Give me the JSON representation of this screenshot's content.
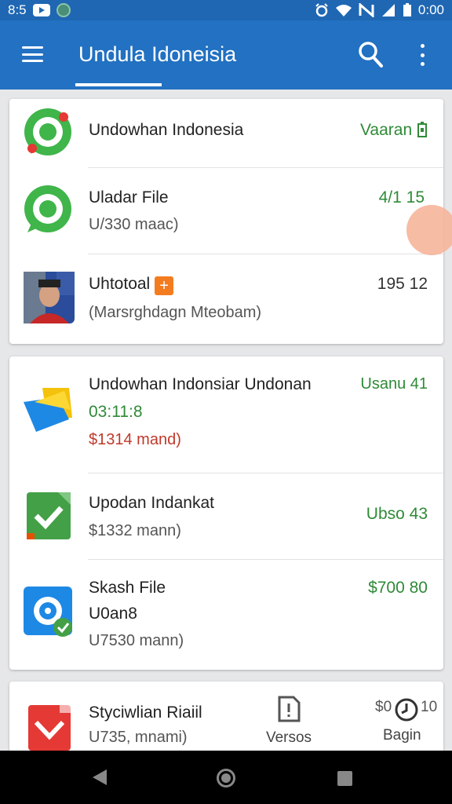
{
  "status_bar": {
    "time_left": "8:5",
    "time_right": "0:00"
  },
  "app_bar": {
    "title": "Undula Idoneisia"
  },
  "card1": [
    {
      "title": "Undowhan Indonesia",
      "right": "Vaaran"
    },
    {
      "title": "Uladar File",
      "subtitle": "U/330 maac)",
      "right": "4/1 15"
    },
    {
      "title": "Uhtotoal",
      "subtitle": "(Marsrghdagn Mteobam)",
      "right": "195 12"
    }
  ],
  "card2": [
    {
      "title": "Undowhan Indonsiar Undonan",
      "line2": "03:11:8",
      "line3": "$1314 mand)",
      "right": "Usanu 41"
    },
    {
      "title": "Upodan Indankat",
      "subtitle": "$1332 mann)",
      "right": "Ubso 43"
    },
    {
      "title": "Skash File",
      "line2": "U0an8",
      "subtitle": "U7530 mann)",
      "right": "$700 80"
    }
  ],
  "card3": {
    "title": "Styciwlian Riaiil",
    "subtitle": "U735, mnami)",
    "action1": "Versos",
    "right_top": "$0",
    "right_num": "10",
    "action2": "Bagin"
  },
  "colors": {
    "primary": "#2271c2",
    "status": "#1f67b3",
    "green": "#2f8a37",
    "red": "#c0392b"
  }
}
